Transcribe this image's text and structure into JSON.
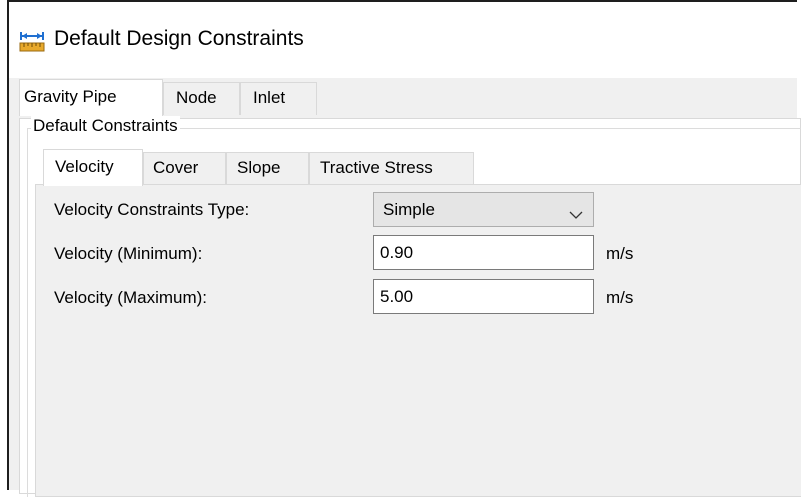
{
  "window": {
    "title": "Default Design Constraints",
    "icon": "dimension-ruler-icon"
  },
  "outer_tabs": [
    {
      "label": "Gravity Pipe",
      "active": true
    },
    {
      "label": "Node",
      "active": false
    },
    {
      "label": "Inlet",
      "active": false
    }
  ],
  "group": {
    "label": "Default Constraints"
  },
  "inner_tabs": [
    {
      "label": "Velocity",
      "active": true
    },
    {
      "label": "Cover",
      "active": false
    },
    {
      "label": "Slope",
      "active": false
    },
    {
      "label": "Tractive Stress",
      "active": false
    }
  ],
  "fields": {
    "type": {
      "label": "Velocity Constraints Type:",
      "value": "Simple"
    },
    "minimum": {
      "label": "Velocity (Minimum):",
      "value": "0.90",
      "unit": "m/s"
    },
    "maximum": {
      "label": "Velocity (Maximum):",
      "value": "5.00",
      "unit": "m/s"
    }
  }
}
